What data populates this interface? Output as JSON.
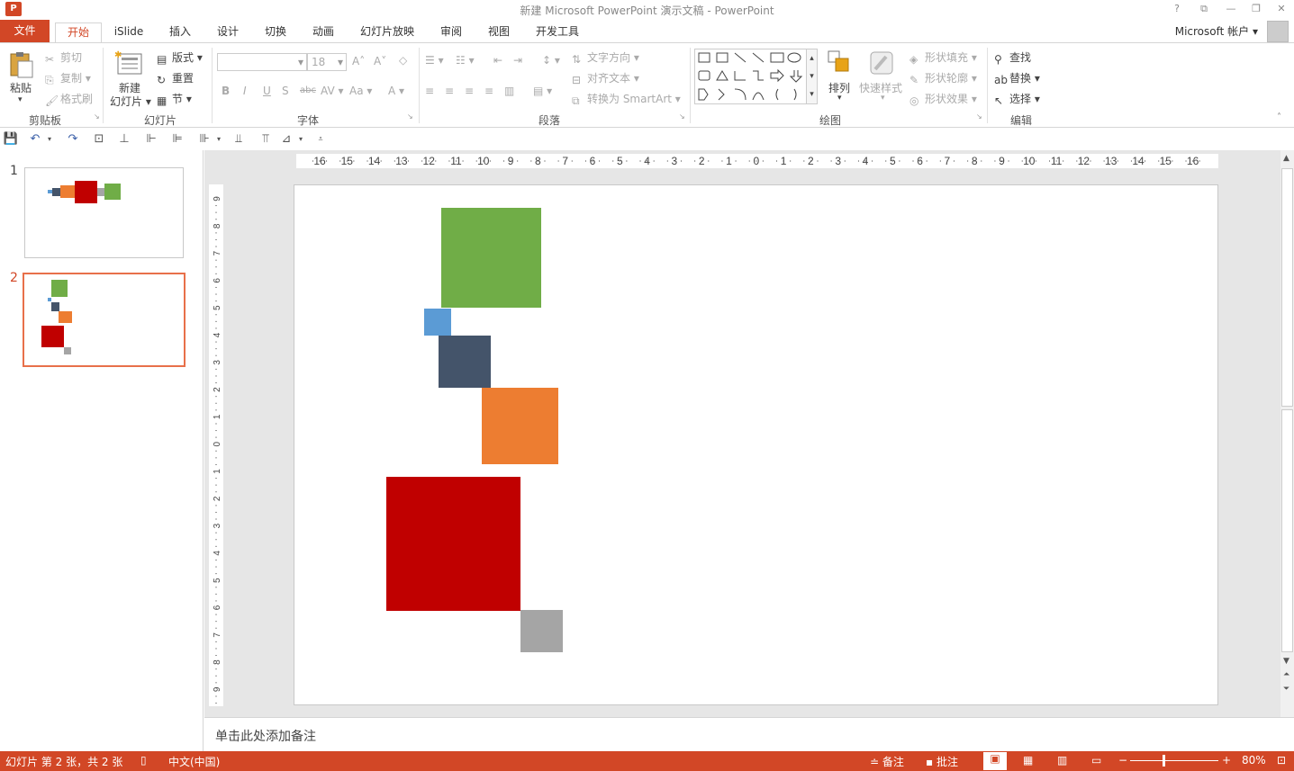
{
  "window": {
    "title": "新建 Microsoft PowerPoint 演示文稿 - PowerPoint",
    "help": "?",
    "restore_ribbon": "⧉",
    "minimize": "—",
    "maximize": "❐",
    "close": "✕"
  },
  "tabs": [
    "文件",
    "开始",
    "iSlide",
    "插入",
    "设计",
    "切换",
    "动画",
    "幻灯片放映",
    "审阅",
    "视图",
    "开发工具"
  ],
  "account": "Microsoft 帐户",
  "ribbon": {
    "clipboard": {
      "label": "剪贴板",
      "paste": "粘贴",
      "cut": "剪切",
      "copy": "复制",
      "format_painter": "格式刷"
    },
    "slides": {
      "label": "幻灯片",
      "new_slide_line1": "新建",
      "new_slide_line2": "幻灯片",
      "layout": "版式",
      "reset": "重置",
      "section": "节"
    },
    "font": {
      "label": "字体",
      "font_name": "",
      "font_size": "18"
    },
    "paragraph": {
      "label": "段落",
      "text_direction": "文字方向",
      "align_text": "对齐文本",
      "convert_smartart": "转换为 SmartArt"
    },
    "drawing": {
      "label": "绘图",
      "arrange": "排列",
      "quick_styles": "快速样式",
      "shape_fill": "形状填充",
      "shape_outline": "形状轮廓",
      "shape_effects": "形状效果"
    },
    "editing": {
      "label": "编辑",
      "find": "查找",
      "replace": "替换",
      "select": "选择"
    }
  },
  "ruler": {
    "horizontal": [
      "16",
      "15",
      "14",
      "13",
      "12",
      "11",
      "10",
      "9",
      "8",
      "7",
      "6",
      "5",
      "4",
      "3",
      "2",
      "1",
      "0",
      "1",
      "2",
      "3",
      "4",
      "5",
      "6",
      "7",
      "8",
      "9",
      "10",
      "11",
      "12",
      "13",
      "14",
      "15",
      "16"
    ],
    "vertical": [
      "9",
      "8",
      "7",
      "6",
      "5",
      "4",
      "3",
      "2",
      "1",
      "0",
      "1",
      "2",
      "3",
      "4",
      "5",
      "6",
      "7",
      "8",
      "9"
    ]
  },
  "thumbnails": [
    {
      "num": "1",
      "selected": false
    },
    {
      "num": "2",
      "selected": true
    }
  ],
  "slide_shapes_colors": {
    "green": "#70ad47",
    "blue": "#5b9bd5",
    "navy": "#44546a",
    "orange": "#ed7d31",
    "red": "#c00000",
    "gray": "#a5a5a5"
  },
  "notes_placeholder": "单击此处添加备注",
  "status": {
    "slide_info": "幻灯片 第 2 张，共 2 张",
    "language": "中文(中国)",
    "notes": "备注",
    "comments": "批注",
    "zoom": "80%"
  },
  "accent_color": "#d24726"
}
